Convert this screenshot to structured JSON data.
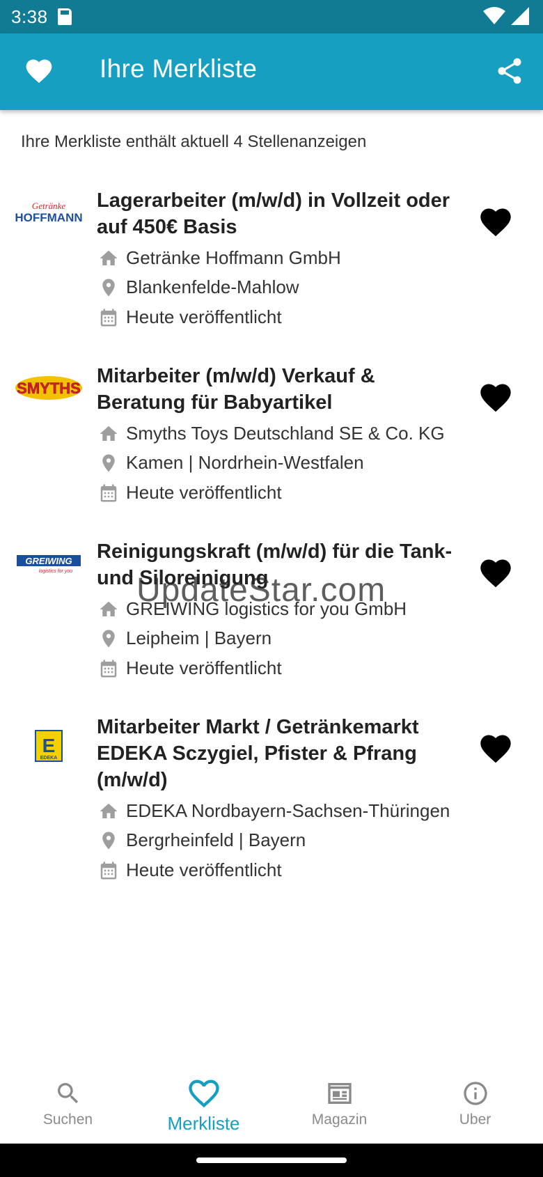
{
  "status": {
    "time": "3:38"
  },
  "app_bar": {
    "title": "Ihre Merkliste"
  },
  "summary": "Ihre Merkliste enthält aktuell 4 Stellenanzeigen",
  "jobs": [
    {
      "logo_text": "Getränke HOFFMANN",
      "title": "Lagerarbeiter (m/w/d) in Vollzeit oder auf 450€ Basis",
      "company": "Getränke Hoffmann GmbH",
      "location": "Blankenfelde-Mahlow",
      "published": "Heute veröffentlicht"
    },
    {
      "logo_text": "SMYTHS",
      "title": "Mitarbeiter (m/w/d) Verkauf & Beratung für Babyartikel",
      "company": "Smyths Toys Deutschland SE & Co. KG",
      "location": "Kamen | Nordrhein-Westfalen",
      "published": "Heute veröffentlicht"
    },
    {
      "logo_text": "GREIWING logistics for you",
      "title": "Reinigungskraft (m/w/d) für die Tank- und Siloreinigung",
      "company": "GREIWING logistics for you GmbH",
      "location": "Leipheim | Bayern",
      "published": "Heute veröffentlicht"
    },
    {
      "logo_text": "E EDEKA",
      "title": "Mitarbeiter Markt / Getränkemarkt EDEKA Sczygiel, Pfister & Pfrang (m/w/d)",
      "company": "EDEKA Nordbayern-Sachsen-Thüringen",
      "location": "Bergrheinfeld | Bayern",
      "published": "Heute veröffentlicht"
    }
  ],
  "watermark": "UpdateStar.com",
  "nav": [
    {
      "label": "Suchen",
      "icon": "search-icon"
    },
    {
      "label": "Merkliste",
      "icon": "heart-outline-icon"
    },
    {
      "label": "Magazin",
      "icon": "newspaper-icon"
    },
    {
      "label": "Uber",
      "icon": "info-icon"
    }
  ],
  "colors": {
    "status_bar": "#117b94",
    "app_bar": "#169fc0",
    "accent": "#169fc0",
    "nav_inactive": "#8a8a8a"
  }
}
